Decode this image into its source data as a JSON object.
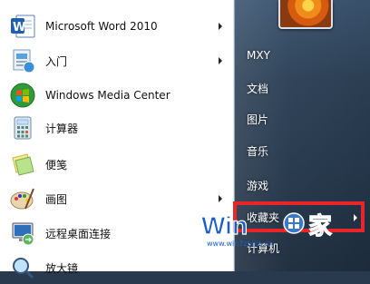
{
  "programs": [
    {
      "label": "Microsoft Word 2010",
      "icon": "word-icon",
      "has_arrow": true
    },
    {
      "label": "入门",
      "icon": "getting-started-icon",
      "has_arrow": true
    },
    {
      "label": "Windows Media Center",
      "icon": "media-center-icon",
      "has_arrow": false
    },
    {
      "label": "计算器",
      "icon": "calculator-icon",
      "has_arrow": false
    },
    {
      "label": "便笺",
      "icon": "sticky-notes-icon",
      "has_arrow": false
    },
    {
      "label": "画图",
      "icon": "paint-icon",
      "has_arrow": true
    },
    {
      "label": "远程桌面连接",
      "icon": "remote-desktop-icon",
      "has_arrow": false
    },
    {
      "label": "放大镜",
      "icon": "magnifier-icon",
      "has_arrow": false
    }
  ],
  "right_menu": [
    {
      "label": "MXY"
    },
    {
      "label": "文档"
    },
    {
      "label": "图片"
    },
    {
      "label": "音乐"
    },
    {
      "label": "游戏"
    },
    {
      "label": "收藏夹"
    },
    {
      "label": "计算机"
    }
  ],
  "watermark": {
    "text_left": "Win",
    "text_right": "家",
    "url": "www.win7zhijia.cn"
  },
  "colors": {
    "highlight": "#e8262a",
    "right_pane": "#2d4156"
  }
}
